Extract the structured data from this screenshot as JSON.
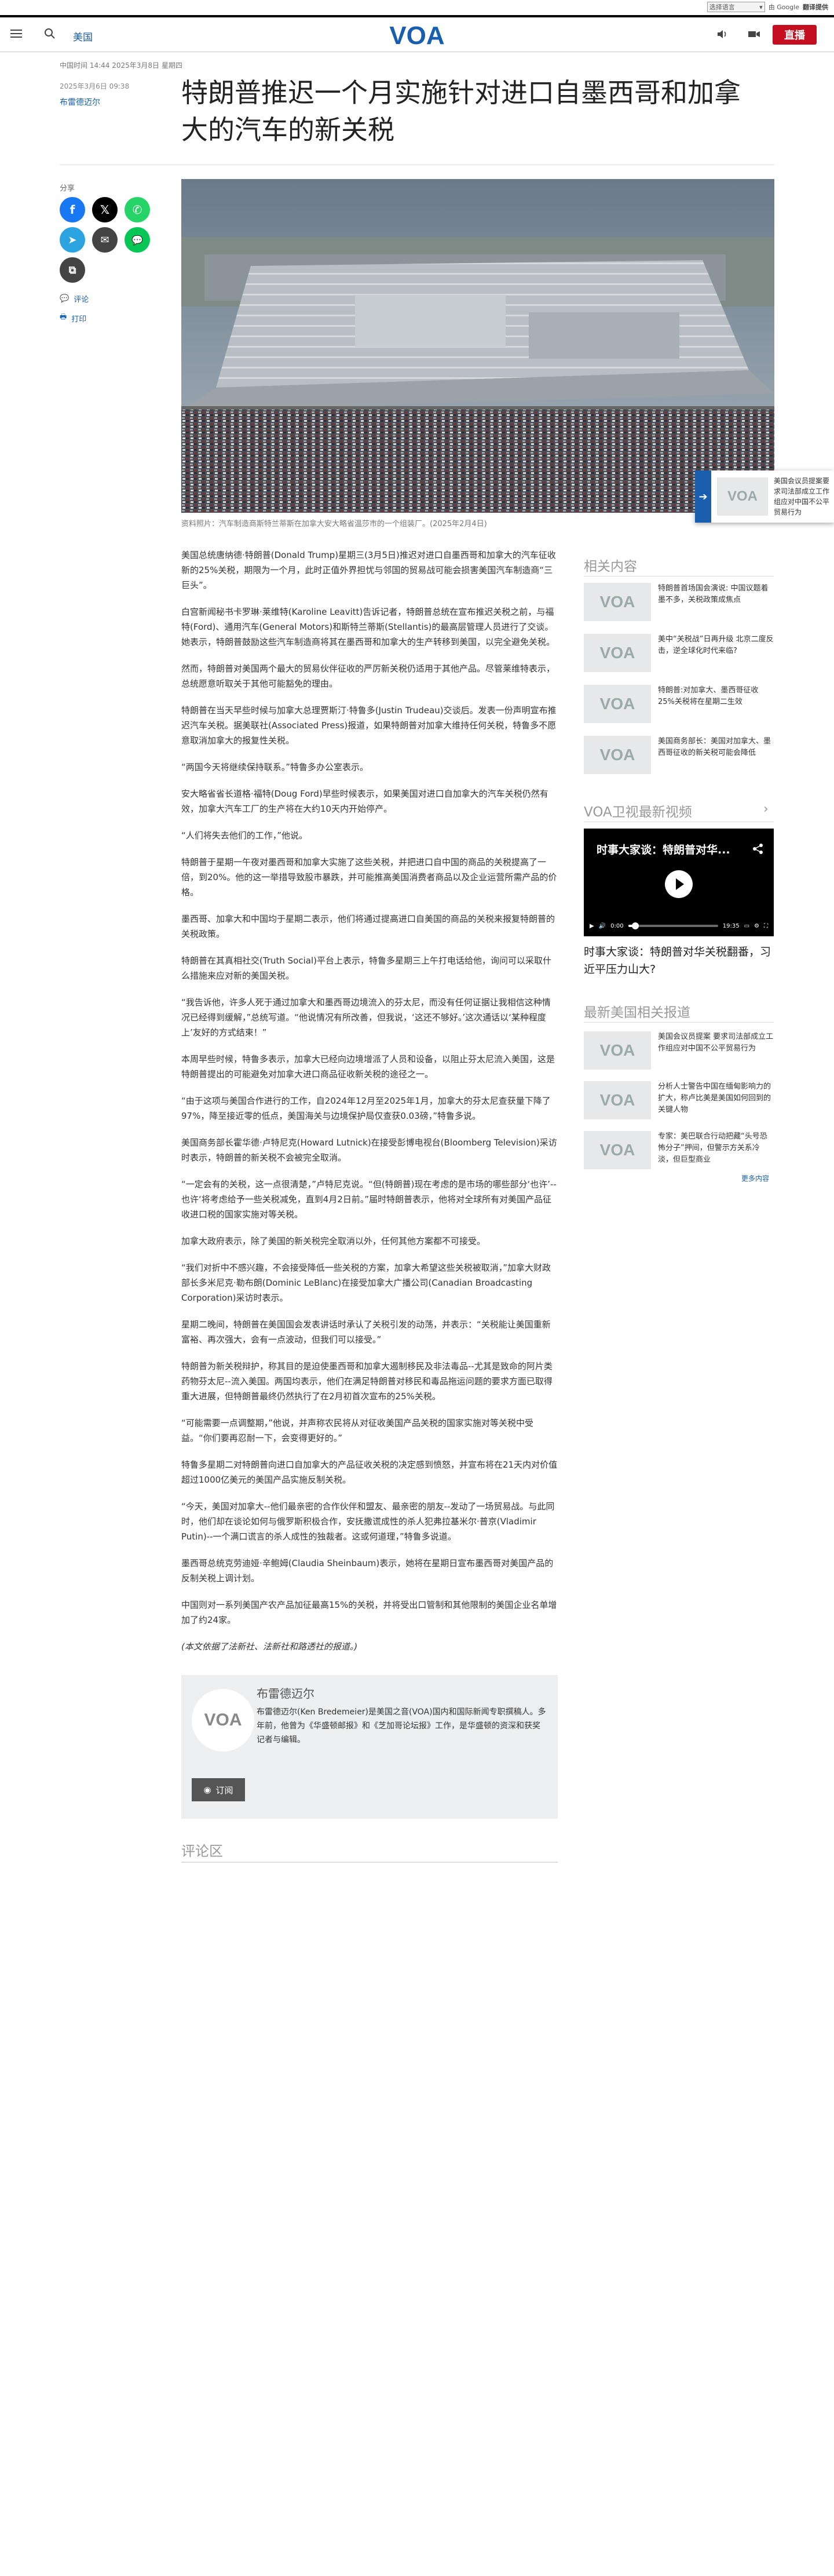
{
  "translate_bar": {
    "select_label": "选择语言",
    "powered_by": "由 Google",
    "service": "翻译提供"
  },
  "header": {
    "nav_link": "美国",
    "logo_text": "VOA",
    "live_label": "直播"
  },
  "meta": {
    "updated": "中国时间 14:44 2025年3月8日 星期四",
    "published": "2025年3月6日 09:38",
    "author": "布雷德迈尔"
  },
  "article": {
    "title": "特朗普推迟一个月实施针对进口自墨西哥和加拿大的汽车的新关税",
    "share_label": "分享",
    "comments_link": "评论",
    "print_link": "打印",
    "image_caption": "资料照片：汽车制造商斯特兰蒂斯在加拿大安大略省温莎市的一个组装厂。(2025年2月4日)",
    "paragraphs": [
      "美国总统唐纳德·特朗普(Donald Trump)星期三(3月5日)推迟对进口自墨西哥和加拿大的汽车征收新的25%关税，期限为一个月，此时正值外界担忧与邻国的贸易战可能会损害美国汽车制造商“三巨头”。",
      "白宫新闻秘书卡罗琳·莱维特(Karoline Leavitt)告诉记者，特朗普总统在宣布推迟关税之前，与福特(Ford)、通用汽车(General Motors)和斯特兰蒂斯(Stellantis)的最高层管理人员进行了交谈。她表示，特朗普鼓励这些汽车制造商将其在墨西哥和加拿大的生产转移到美国，以完全避免关税。",
      "然而，特朗普对美国两个最大的贸易伙伴征收的严厉新关税仍适用于其他产品。尽管莱维特表示，总统愿意听取关于其他可能豁免的理由。",
      "特朗普在当天早些时候与加拿大总理贾斯汀·特鲁多(Justin Trudeau)交谈后。发表一份声明宣布推迟汽车关税。据美联社(Associated Press)报道，如果特朗普对加拿大维持任何关税，特鲁多不愿意取消加拿大的报复性关税。",
      "“两国今天将继续保持联系。”特鲁多办公室表示。",
      "安大略省省长道格·福特(Doug Ford)早些时候表示，如果美国对进口自加拿大的汽车关税仍然有效，加拿大汽车工厂的生产将在大约10天内开始停产。",
      "“人们将失去他们的工作，”他说。",
      "特朗普于星期一午夜对墨西哥和加拿大实施了这些关税，并把进口自中国的商品的关税提高了一倍，到20%。他的这一举措导致股市暴跌，并可能推高美国消费者商品以及企业运营所需产品的价格。",
      "墨西哥、加拿大和中国均于星期二表示，他们将通过提高进口自美国的商品的关税来报复特朗普的关税政策。",
      "特朗普在其真相社交(Truth Social)平台上表示，特鲁多星期三上午打电话给他，询问可以采取什么措施来应对新的美国关税。",
      "“我告诉他，许多人死于通过加拿大和墨西哥边境流入的芬太尼，而没有任何证据让我相信这种情况已经得到缓解，”总统写道。“他说情况有所改善，但我说，‘这还不够好。’这次通话以‘某种程度上’友好的方式结束！”",
      "本周早些时候，特鲁多表示，加拿大已经向边境增派了人员和设备，以阻止芬太尼流入美国，这是特朗普提出的可能避免对加拿大进口商品征收新关税的途径之一。",
      "“由于这项与美国合作进行的工作，自2024年12月至2025年1月，加拿大的芬太尼查获量下降了97%，降至接近零的低点，美国海关与边境保护局仅查获0.03磅，”特鲁多说。",
      "美国商务部长霍华德·卢特尼克(Howard Lutnick)在接受彭博电视台(Bloomberg Television)采访时表示，特朗普的新关税不会被完全取消。",
      "“一定会有的关税，这一点很清楚，”卢特尼克说。“但(特朗普)现在考虑的是市场的哪些部分‘也许’--也许‘将考虑给予一些关税减免，直到4月2日前。”届时特朗普表示，他将对全球所有对美国产品征收进口税的国家实施对等关税。",
      "加拿大政府表示，除了美国的新关税完全取消以外，任何其他方案都不可接受。",
      "“我们对折中不感兴趣，不会接受降低一些关税的方案，加拿大希望这些关税被取消，”加拿大财政部长多米尼克·勒布朗(Dominic LeBlanc)在接受加拿大广播公司(Canadian Broadcasting Corporation)采访时表示。",
      "星期二晚间，特朗普在美国国会发表讲话时承认了关税引发的动荡，并表示：“关税能让美国重新富裕、再次强大，会有一点波动，但我们可以接受。”",
      "特朗普为新关税辩护，称其目的是迫使墨西哥和加拿大遏制移民及非法毒品--尤其是致命的阿片类药物芬太尼--流入美国。两国均表示，他们在满足特朗普对移民和毒品拖运问题的要求方面已取得重大进展，但特朗普最终仍然执行了在2月初首次宣布的25%关税。",
      "“可能需要一点调整期，”他说，并声称农民将从对征收美国产品关税的国家实施对等关税中受益。“你们要再忍耐一下，会变得更好的。”",
      "特鲁多星期二对特朗普向进口自加拿大的产品征收关税的决定感到愤怒，并宣布将在21天内对价值超过1000亿美元的美国产品实施反制关税。",
      "“今天，美国对加拿大--他们最亲密的合作伙伴和盟友、最亲密的朋友--发动了一场贸易战。与此同时，他们却在谈论如何与俄罗斯积极合作，安抚撒谎成性的杀人犯弗拉基米尔·普京(Vladimir Putin)--一个满口谎言的杀人成性的独裁者。这或何道理，”特鲁多说道。",
      "墨西哥总统克劳迪娅·辛鲍姆(Claudia Sheinbaum)表示，她将在星期日宣布墨西哥对美国产品的反制关税上调计划。",
      "中国则对一系列美国产农产品加征最高15%的关税，并将受出口管制和其他限制的美国企业名单增加了约24家。"
    ],
    "source_note": "(本文依据了法新社、法新社和路透社的报道。)"
  },
  "author_box": {
    "name": "布雷德迈尔",
    "bio": "布雷德迈尔(Ken Bredemeier)是美国之音(VOA)国内和国际新闻专职撰稿人。多年前，他曾为《华盛顿邮报》和《芝加哥论坛报》工作，是华盛顿的资深和获奖记者与编辑。",
    "subscribe_label": "订阅"
  },
  "comments": {
    "title": "评论区"
  },
  "sidebar": {
    "related_title": "相关内容",
    "related": [
      "特朗普首场国会演说: 中国议题着墨不多，关税政策成焦点",
      "美中“关税战”日再升级 北京二度反击，逆全球化时代来临?",
      "特朗普:对加拿大、墨西哥征收25%关税将在星期二生效",
      "美国商务部长：美国对加拿大、墨西哥征收的新关税可能会降低"
    ],
    "video_section_title": "VOA卫视最新视频",
    "video": {
      "overlay_title": "时事大家谈：特朗普对华...",
      "time_current": "0:00",
      "time_total": "19:35",
      "progress": 0.08,
      "caption": "时事大家谈：特朗普对华关税翻番，习近平压力山大?"
    },
    "latest_title": "最新美国相关报道",
    "latest": [
      "美国会议员提案 要求司法部成立工作组应对中国不公平贸易行为",
      "分析人士警告中国在缅甸影响力的扩大，称卢比美是美国如何回到的关键人物",
      "专家：美巴联合行动把藏“头号恐怖分子”押间，但警示方关系冷淡，但巨型商业"
    ],
    "more_label": "更多内容"
  },
  "popup": {
    "text": "美国会议员提案要求司法部成立工作组应对中国不公平贸易行为"
  }
}
